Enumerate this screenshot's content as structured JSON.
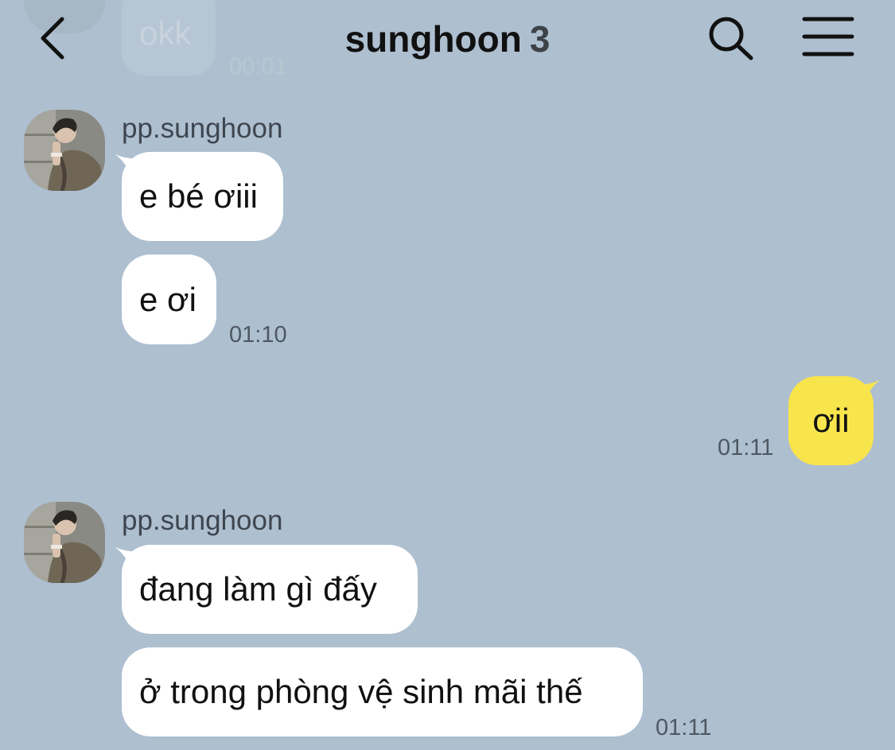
{
  "header": {
    "title": "sunghoon",
    "member_count": "3"
  },
  "previous": {
    "text": "okk",
    "time": "00:01"
  },
  "messages": [
    {
      "sender": "pp.sunghoon",
      "bubbles": [
        "e bé ơiii",
        "e ơi"
      ],
      "time": "01:10"
    },
    {
      "sender": "me",
      "bubbles": [
        "ơii"
      ],
      "time": "01:11"
    },
    {
      "sender": "pp.sunghoon",
      "bubbles": [
        "đang làm gì đấy",
        "ở trong phòng vệ sinh mãi thế"
      ],
      "time": "01:11"
    }
  ],
  "colors": {
    "background": "#aebfd0",
    "incoming_bubble": "#ffffff",
    "outgoing_bubble": "#f8e54c"
  },
  "icons": [
    "back-arrow-icon",
    "search-icon",
    "menu-icon"
  ]
}
